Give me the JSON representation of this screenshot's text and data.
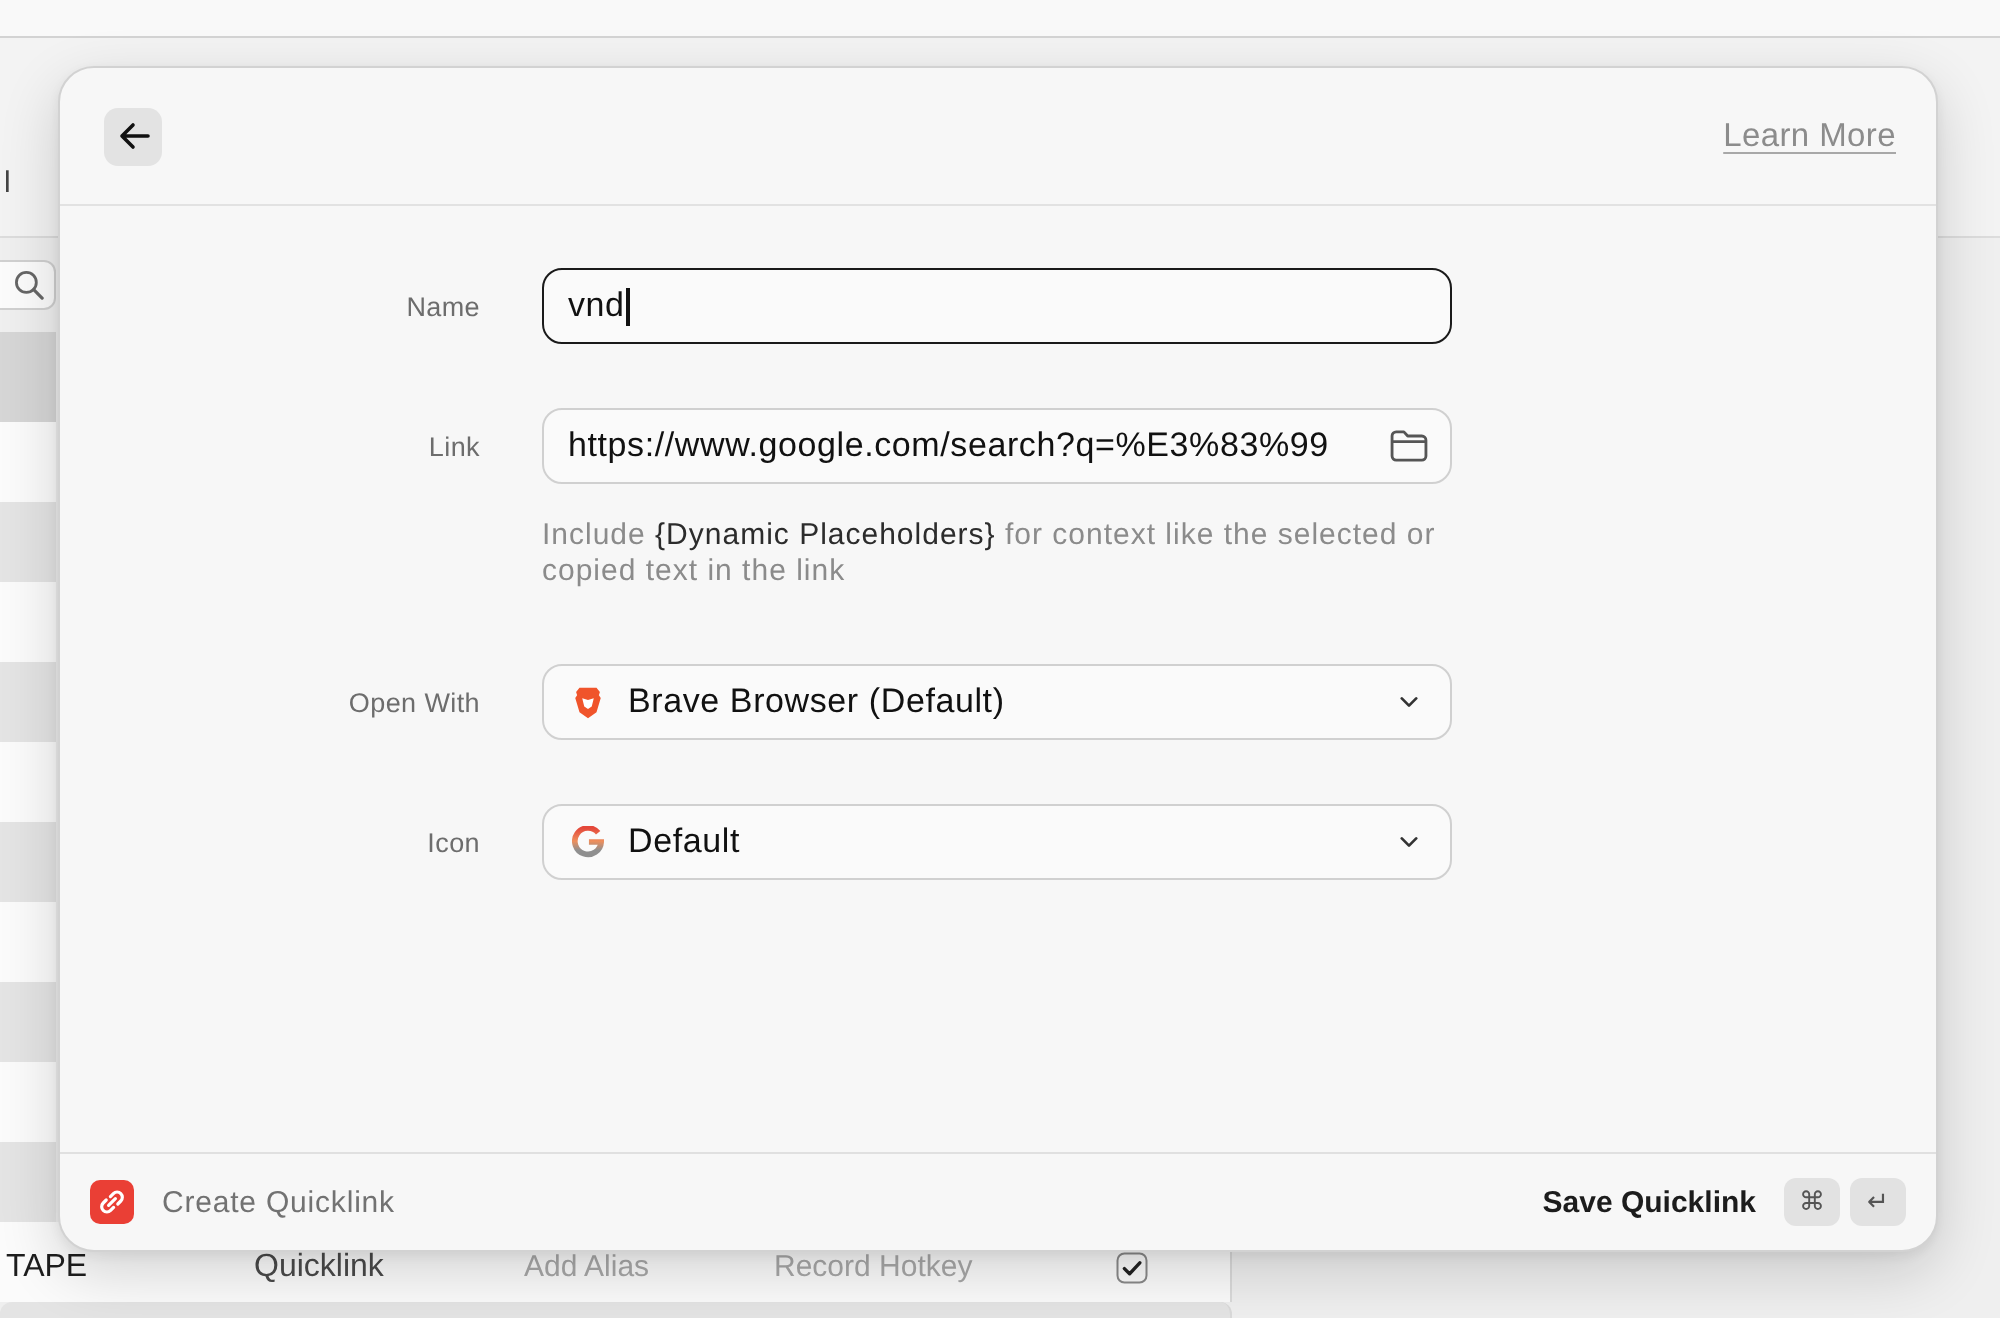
{
  "settings_window": {
    "text_fragment": "l",
    "rows": [
      {
        "selected": true
      },
      {
        "selected": false
      },
      {
        "selected": false
      },
      {
        "selected": false
      },
      {
        "selected": false
      },
      {
        "selected": false
      },
      {
        "selected": false
      },
      {
        "selected": false
      },
      {
        "selected": false
      },
      {
        "selected": false
      },
      {
        "selected": false
      },
      {
        "selected": false,
        "name": "TAPE",
        "type": "Quicklink",
        "alias": "Add Alias",
        "hotkey": "Record Hotkey",
        "enabled": true
      },
      {
        "selected": false
      }
    ]
  },
  "dialog": {
    "learn_more": "Learn More",
    "fields": [
      {
        "kind": "text",
        "label": "Name",
        "value": "vnd",
        "focused": true
      },
      {
        "kind": "link",
        "label": "Link",
        "value": "https://www.google.com/search?q=%E3%83%99",
        "focused": false,
        "hint": "Include **{Dynamic Placeholders}** for context like the selected or copied text in the link"
      },
      {
        "kind": "browser",
        "label": "Open With",
        "value": "Brave Browser (Default)",
        "focused": false
      },
      {
        "kind": "icon",
        "label": "Icon",
        "value": "Default",
        "focused": false
      }
    ],
    "footer": {
      "title": "Create Quicklink",
      "action": "Save Quicklink",
      "shortcut": [
        "⌘",
        "↵"
      ]
    }
  }
}
